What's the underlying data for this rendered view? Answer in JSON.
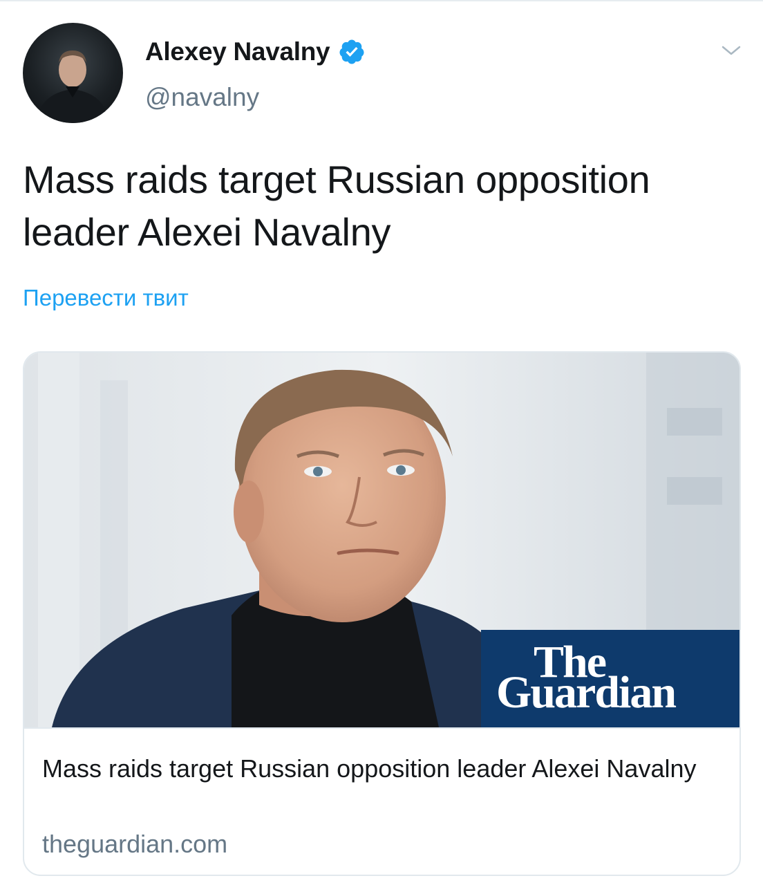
{
  "author": {
    "display_name": "Alexey Navalny",
    "handle": "@navalny",
    "verified": true
  },
  "tweet": {
    "text": "Mass raids target Russian opposition leader Alexei Navalny",
    "translate_label": "Перевести твит"
  },
  "card": {
    "brand_line1": "The",
    "brand_line2": "Guardian",
    "title": "Mass raids target Russian opposition leader Alexei Navalny",
    "domain": "theguardian.com"
  },
  "colors": {
    "link": "#1da1f2",
    "secondary_text": "#657786",
    "guardian_blue": "#0e3a6c"
  },
  "icons": {
    "verified": "verified-badge-icon",
    "caret": "chevron-down-icon"
  }
}
